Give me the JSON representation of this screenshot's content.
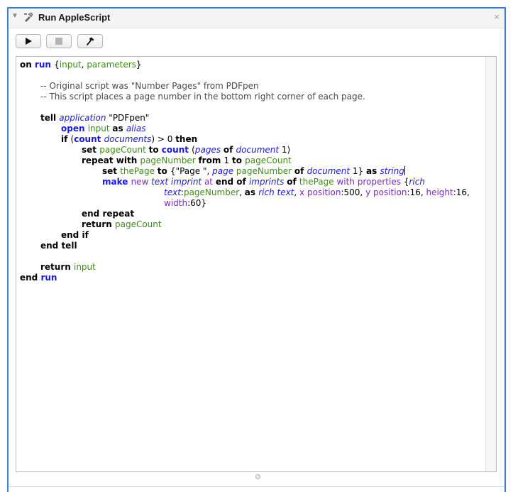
{
  "action": {
    "title": "Run AppleScript",
    "disclosure_glyph": "▼",
    "close_glyph": "×",
    "accent_color": "#3d7fd6"
  },
  "toolbar": {
    "buttons": [
      "run",
      "stop",
      "compile"
    ]
  },
  "code": {
    "lines": [
      [
        [
          "kw",
          "on "
        ],
        [
          "kb",
          "run "
        ],
        [
          "",
          "{"
        ],
        [
          "vr",
          "input"
        ],
        [
          "",
          ", "
        ],
        [
          "vr",
          "parameters"
        ],
        [
          "",
          "}"
        ]
      ],
      [],
      [
        [
          "cm",
          "\t-- Original script was \"Number Pages\" from PDFpen"
        ]
      ],
      [
        [
          "cm",
          "\t-- This script places a page number in the bottom right corner of each page."
        ]
      ],
      [],
      [
        [
          "kw",
          "\ttell "
        ],
        [
          "ap",
          "application "
        ],
        [
          "",
          "\"PDFpen\""
        ]
      ],
      [
        [
          "kb",
          "\t\topen "
        ],
        [
          "vr",
          "input "
        ],
        [
          "kw",
          "as "
        ],
        [
          "ap",
          "alias"
        ]
      ],
      [
        [
          "kw",
          "\t\tif "
        ],
        [
          "",
          "("
        ],
        [
          "kb",
          "count "
        ],
        [
          "ap",
          "documents"
        ],
        [
          "",
          ") > 0 "
        ],
        [
          "kw",
          "then"
        ]
      ],
      [
        [
          "kw",
          "\t\t\tset "
        ],
        [
          "vr",
          "pageCount "
        ],
        [
          "kw",
          "to "
        ],
        [
          "kb",
          "count "
        ],
        [
          "",
          "("
        ],
        [
          "ap",
          "pages "
        ],
        [
          "kw",
          "of "
        ],
        [
          "ap",
          "document "
        ],
        [
          "",
          "1)"
        ]
      ],
      [
        [
          "kw",
          "\t\t\trepeat with "
        ],
        [
          "vr",
          "pageNumber "
        ],
        [
          "kw",
          "from "
        ],
        [
          "",
          "1 "
        ],
        [
          "kw",
          "to "
        ],
        [
          "vr",
          "pageCount"
        ]
      ],
      [
        [
          "kw",
          "\t\t\t\tset "
        ],
        [
          "vr",
          "thePage "
        ],
        [
          "kw",
          "to "
        ],
        [
          "",
          "{\"Page \", "
        ],
        [
          "ap",
          "page "
        ],
        [
          "vr",
          "pageNumber "
        ],
        [
          "kw",
          "of "
        ],
        [
          "ap",
          "document "
        ],
        [
          "",
          "1} "
        ],
        [
          "kw",
          "as "
        ],
        [
          "ap",
          "string"
        ]
      ],
      [
        [
          "kb",
          "\t\t\t\tmake "
        ],
        [
          "pr",
          "new "
        ],
        [
          "ap",
          "text imprint "
        ],
        [
          "pr",
          "at "
        ],
        [
          "kw",
          "end "
        ],
        [
          "kw",
          "of "
        ],
        [
          "ap",
          "imprints "
        ],
        [
          "kw",
          "of "
        ],
        [
          "vr",
          "thePage "
        ],
        [
          "pr",
          "with properties "
        ],
        [
          "",
          "{"
        ],
        [
          "ap",
          "rich"
        ]
      ],
      [
        [
          "",
          "\t\t\t\t\t\t\t"
        ],
        [
          "ap",
          "text"
        ],
        [
          "",
          ":"
        ],
        [
          "vr",
          "pageNumber"
        ],
        [
          "",
          ", "
        ],
        [
          "kw",
          "as "
        ],
        [
          "ap",
          "rich text"
        ],
        [
          "",
          ", "
        ],
        [
          "pr",
          "x position"
        ],
        [
          "",
          ":500, "
        ],
        [
          "pr",
          "y position"
        ],
        [
          "",
          ":16, "
        ],
        [
          "pr",
          "height"
        ],
        [
          "",
          ":16,"
        ]
      ],
      [
        [
          "",
          "\t\t\t\t\t\t\t"
        ],
        [
          "pr",
          "width"
        ],
        [
          "",
          ":60}"
        ]
      ],
      [
        [
          "kw",
          "\t\t\tend repeat"
        ]
      ],
      [
        [
          "kw",
          "\t\t\treturn "
        ],
        [
          "vr",
          "pageCount"
        ]
      ],
      [
        [
          "kw",
          "\t\tend if"
        ]
      ],
      [
        [
          "kw",
          "\tend tell"
        ]
      ],
      [],
      [
        [
          "kw",
          "\treturn "
        ],
        [
          "vr",
          "input"
        ]
      ],
      [
        [
          "kw",
          "end "
        ],
        [
          "kb",
          "run"
        ]
      ]
    ]
  }
}
